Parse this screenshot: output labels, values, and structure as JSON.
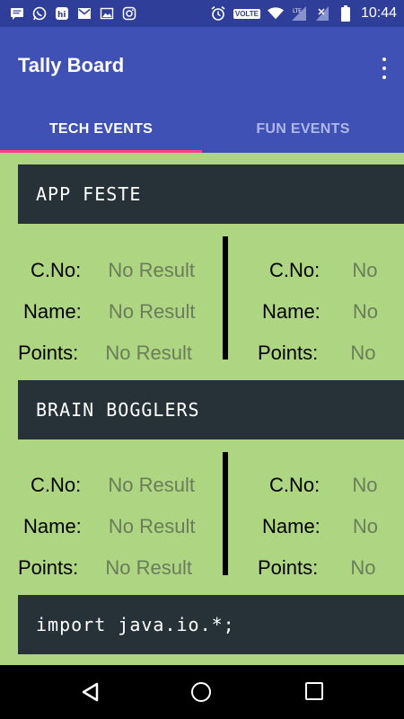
{
  "status_bar": {
    "icons": [
      "message-icon",
      "whatsapp-icon",
      "hike-icon",
      "gmail-icon",
      "image-icon",
      "instagram-icon",
      "alarm-icon",
      "volte-icon",
      "wifi-icon",
      "lte-signal-icon",
      "no-sim-icon",
      "battery-icon"
    ],
    "volte": "VOLTE",
    "time": "10:44"
  },
  "app_bar": {
    "title": "Tally Board",
    "menu_icon": "more-vert-icon"
  },
  "tabs": [
    {
      "label": "TECH EVENTS",
      "active": true
    },
    {
      "label": "FUN EVENTS",
      "active": false
    }
  ],
  "colors": {
    "primary": "#3f51b5",
    "status_bar": "#2f3e98",
    "accent": "#ff4081",
    "content_bg": "#aed581",
    "card_bg": "#263238"
  },
  "events": [
    {
      "name": "APP FESTE",
      "left": {
        "cno_label": "C.No:",
        "cno": "No Result",
        "name_label": "Name:",
        "name": "No Result",
        "points_label": "Points:",
        "points": "No Result"
      },
      "right": {
        "cno_label": "C.No:",
        "cno": "No",
        "name_label": "Name:",
        "name": "No",
        "points_label": "Points:",
        "points": "No"
      }
    },
    {
      "name": "BRAIN BOGGLERS",
      "left": {
        "cno_label": "C.No:",
        "cno": "No Result",
        "name_label": "Name:",
        "name": "No Result",
        "points_label": "Points:",
        "points": "No Result"
      },
      "right": {
        "cno_label": "C.No:",
        "cno": "No",
        "name_label": "Name:",
        "name": "No",
        "points_label": "Points:",
        "points": "No"
      }
    },
    {
      "name": "import java.io.*;"
    }
  ],
  "nav_bar": {
    "icons": [
      "back-icon",
      "home-icon",
      "recents-icon"
    ]
  }
}
